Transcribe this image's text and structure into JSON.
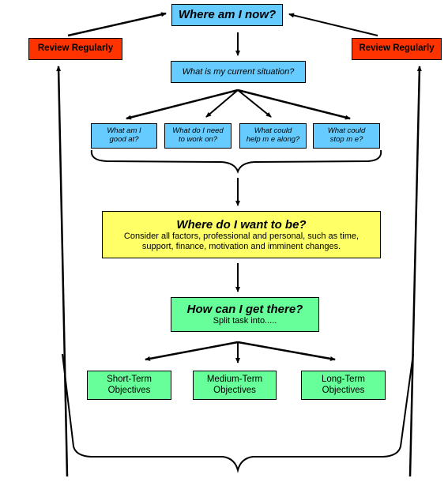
{
  "diagram": {
    "top": {
      "title": "Where am I now?"
    },
    "review_left": {
      "label": "Review Regularly"
    },
    "review_right": {
      "label": "Review Regularly"
    },
    "situation": {
      "label": "What is my current situation?"
    },
    "questions": [
      {
        "line1": "What am I",
        "line2": "good at?"
      },
      {
        "line1": "What do I need",
        "line2": "to work on?"
      },
      {
        "line1": "What could",
        "line2": "help m e along?"
      },
      {
        "line1": "What could",
        "line2": "stop m e?"
      }
    ],
    "want": {
      "title": "Where do I want to be?",
      "line1": "Consider all factors, professional and personal, such as time,",
      "line2": "support, finance, motivation and imminent changes."
    },
    "how": {
      "title": "How can I get there?",
      "subtitle": "Split task into....."
    },
    "objectives": [
      {
        "line1": "Short-Term",
        "line2": "Objectives"
      },
      {
        "line1": "Medium-Term",
        "line2": "Objectives"
      },
      {
        "line1": "Long-Term",
        "line2": "Objectives"
      }
    ],
    "colors": {
      "blue": "#66ccff",
      "red": "#ff3300",
      "yellow": "#ffff66",
      "green": "#66ff99",
      "line": "#000000"
    }
  }
}
